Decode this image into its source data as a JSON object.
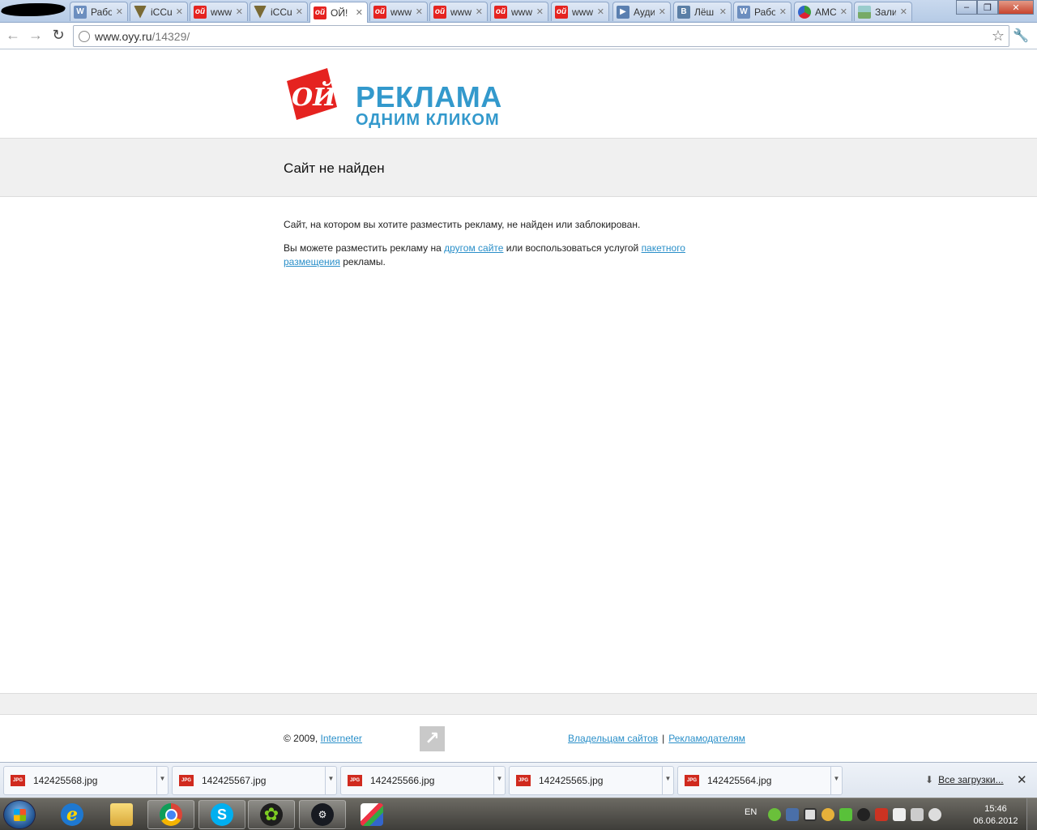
{
  "browser": {
    "tabs": [
      {
        "favicon": "wikipedia-icon",
        "label": "Рабо",
        "active": false
      },
      {
        "favicon": "iccup-icon",
        "label": "iCCu",
        "active": false
      },
      {
        "favicon": "oyy-icon",
        "label": "www",
        "active": false
      },
      {
        "favicon": "iccup-icon",
        "label": "iCCu",
        "active": false
      },
      {
        "favicon": "oyy-icon",
        "label": "ОЙ!",
        "active": true
      },
      {
        "favicon": "oyy-icon",
        "label": "www",
        "active": false
      },
      {
        "favicon": "oyy-icon",
        "label": "www",
        "active": false
      },
      {
        "favicon": "oyy-icon",
        "label": "www",
        "active": false
      },
      {
        "favicon": "oyy-icon",
        "label": "www",
        "active": false
      },
      {
        "favicon": "audio-icon",
        "label": "Ауди",
        "active": false
      },
      {
        "favicon": "vkontakte-icon",
        "label": "Лёш",
        "active": false
      },
      {
        "favicon": "wikipedia-icon",
        "label": "Рабо",
        "active": false
      },
      {
        "favicon": "amo-icon",
        "label": "AMC",
        "active": false
      },
      {
        "favicon": "picture-icon",
        "label": "Зали",
        "active": false
      }
    ],
    "url_host": "www.oyy.ru",
    "url_path": "/14329/"
  },
  "page": {
    "logo_title": "РЕКЛАМА",
    "logo_subtitle": "ОДНИМ КЛИКОМ",
    "logo_mark_text": "ОЙ",
    "heading": "Сайт не найден",
    "para1": "Сайт, на котором вы хотите разместить рекламу, не найден или заблокирован.",
    "para2_before": "Вы можете разместить рекламу на ",
    "para2_link1": "другом сайте",
    "para2_middle": " или воспользоваться услугой ",
    "para2_link2": "пакетного размещения",
    "para2_after": " рекламы.",
    "footer_copyright": "© 2009, ",
    "footer_copyright_link": "Interneter",
    "footer_link_owners": "Владельцам сайтов",
    "footer_link_separator": "|",
    "footer_link_advertisers": "Рекламодателям"
  },
  "downloads": {
    "items": [
      {
        "name": "142425568.jpg"
      },
      {
        "name": "142425567.jpg"
      },
      {
        "name": "142425566.jpg"
      },
      {
        "name": "142425565.jpg"
      },
      {
        "name": "142425564.jpg"
      }
    ],
    "file_badge": "JPG",
    "all_label": "Все загрузки..."
  },
  "taskbar": {
    "language": "EN",
    "time": "15:46",
    "date": "06.06.2012"
  },
  "colors": {
    "brand_blue": "#3399cc",
    "brand_red": "#e52320",
    "link": "#2a8fc9"
  }
}
